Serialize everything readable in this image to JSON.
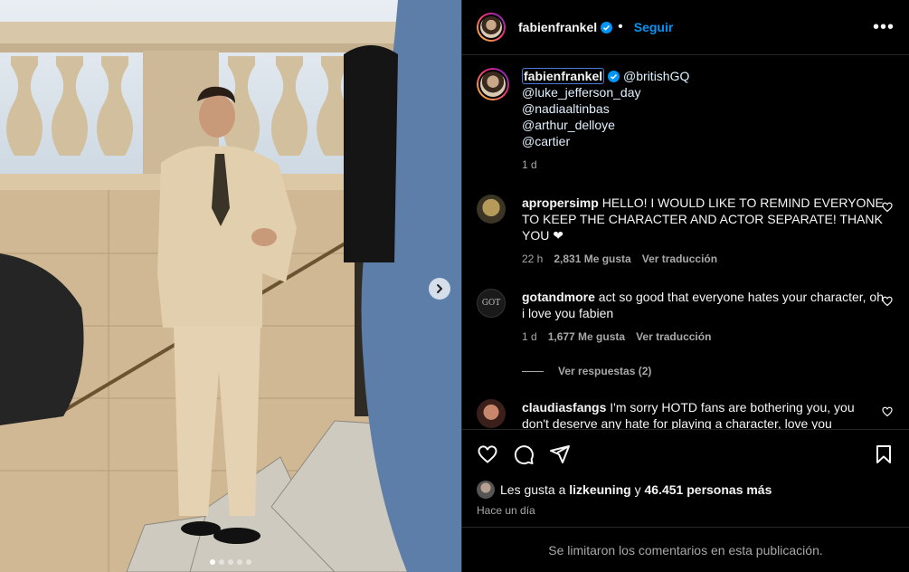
{
  "post": {
    "username": "fabienfrankel",
    "follow_label": "Seguir",
    "more_label": "•••",
    "photo_slides": 5,
    "photo_active_slide": 1
  },
  "caption": {
    "author": "fabienfrankel",
    "mentions": [
      "@britishGQ",
      "@luke_jefferson_day",
      "@nadiaaltinbas",
      "@arthur_delloye",
      "@cartier"
    ],
    "time": "1 d"
  },
  "comments": [
    {
      "user": "apropersimp",
      "text": "HELLO! I WOULD LIKE TO REMIND EVERYONE TO KEEP THE CHARACTER AND ACTOR SEPARATE! THANK YOU ❤",
      "time": "22 h",
      "likes": "2,831 Me gusta",
      "translate": "Ver traducción"
    },
    {
      "user": "gotandmore",
      "text": "act so good that everyone hates your character, oh i love you fabien",
      "time": "1 d",
      "likes": "1,677 Me gusta",
      "translate": "Ver traducción",
      "replies": "Ver respuestas (2)"
    },
    {
      "user": "claudiasfangs",
      "text": "I'm sorry HOTD fans are bothering you, you don't deserve any hate for playing a character, love you"
    }
  ],
  "likes": {
    "prefix": "Les gusta a",
    "user": "lizkeuning",
    "connector": "y",
    "others": "46.451 personas más"
  },
  "posted_ago": "Hace un día",
  "comments_limited": "Se limitaron los comentarios en esta publicación.",
  "colors": {
    "accent": "#0095f6",
    "background": "#000000",
    "muted": "#a8a8a8",
    "border": "#262626"
  }
}
